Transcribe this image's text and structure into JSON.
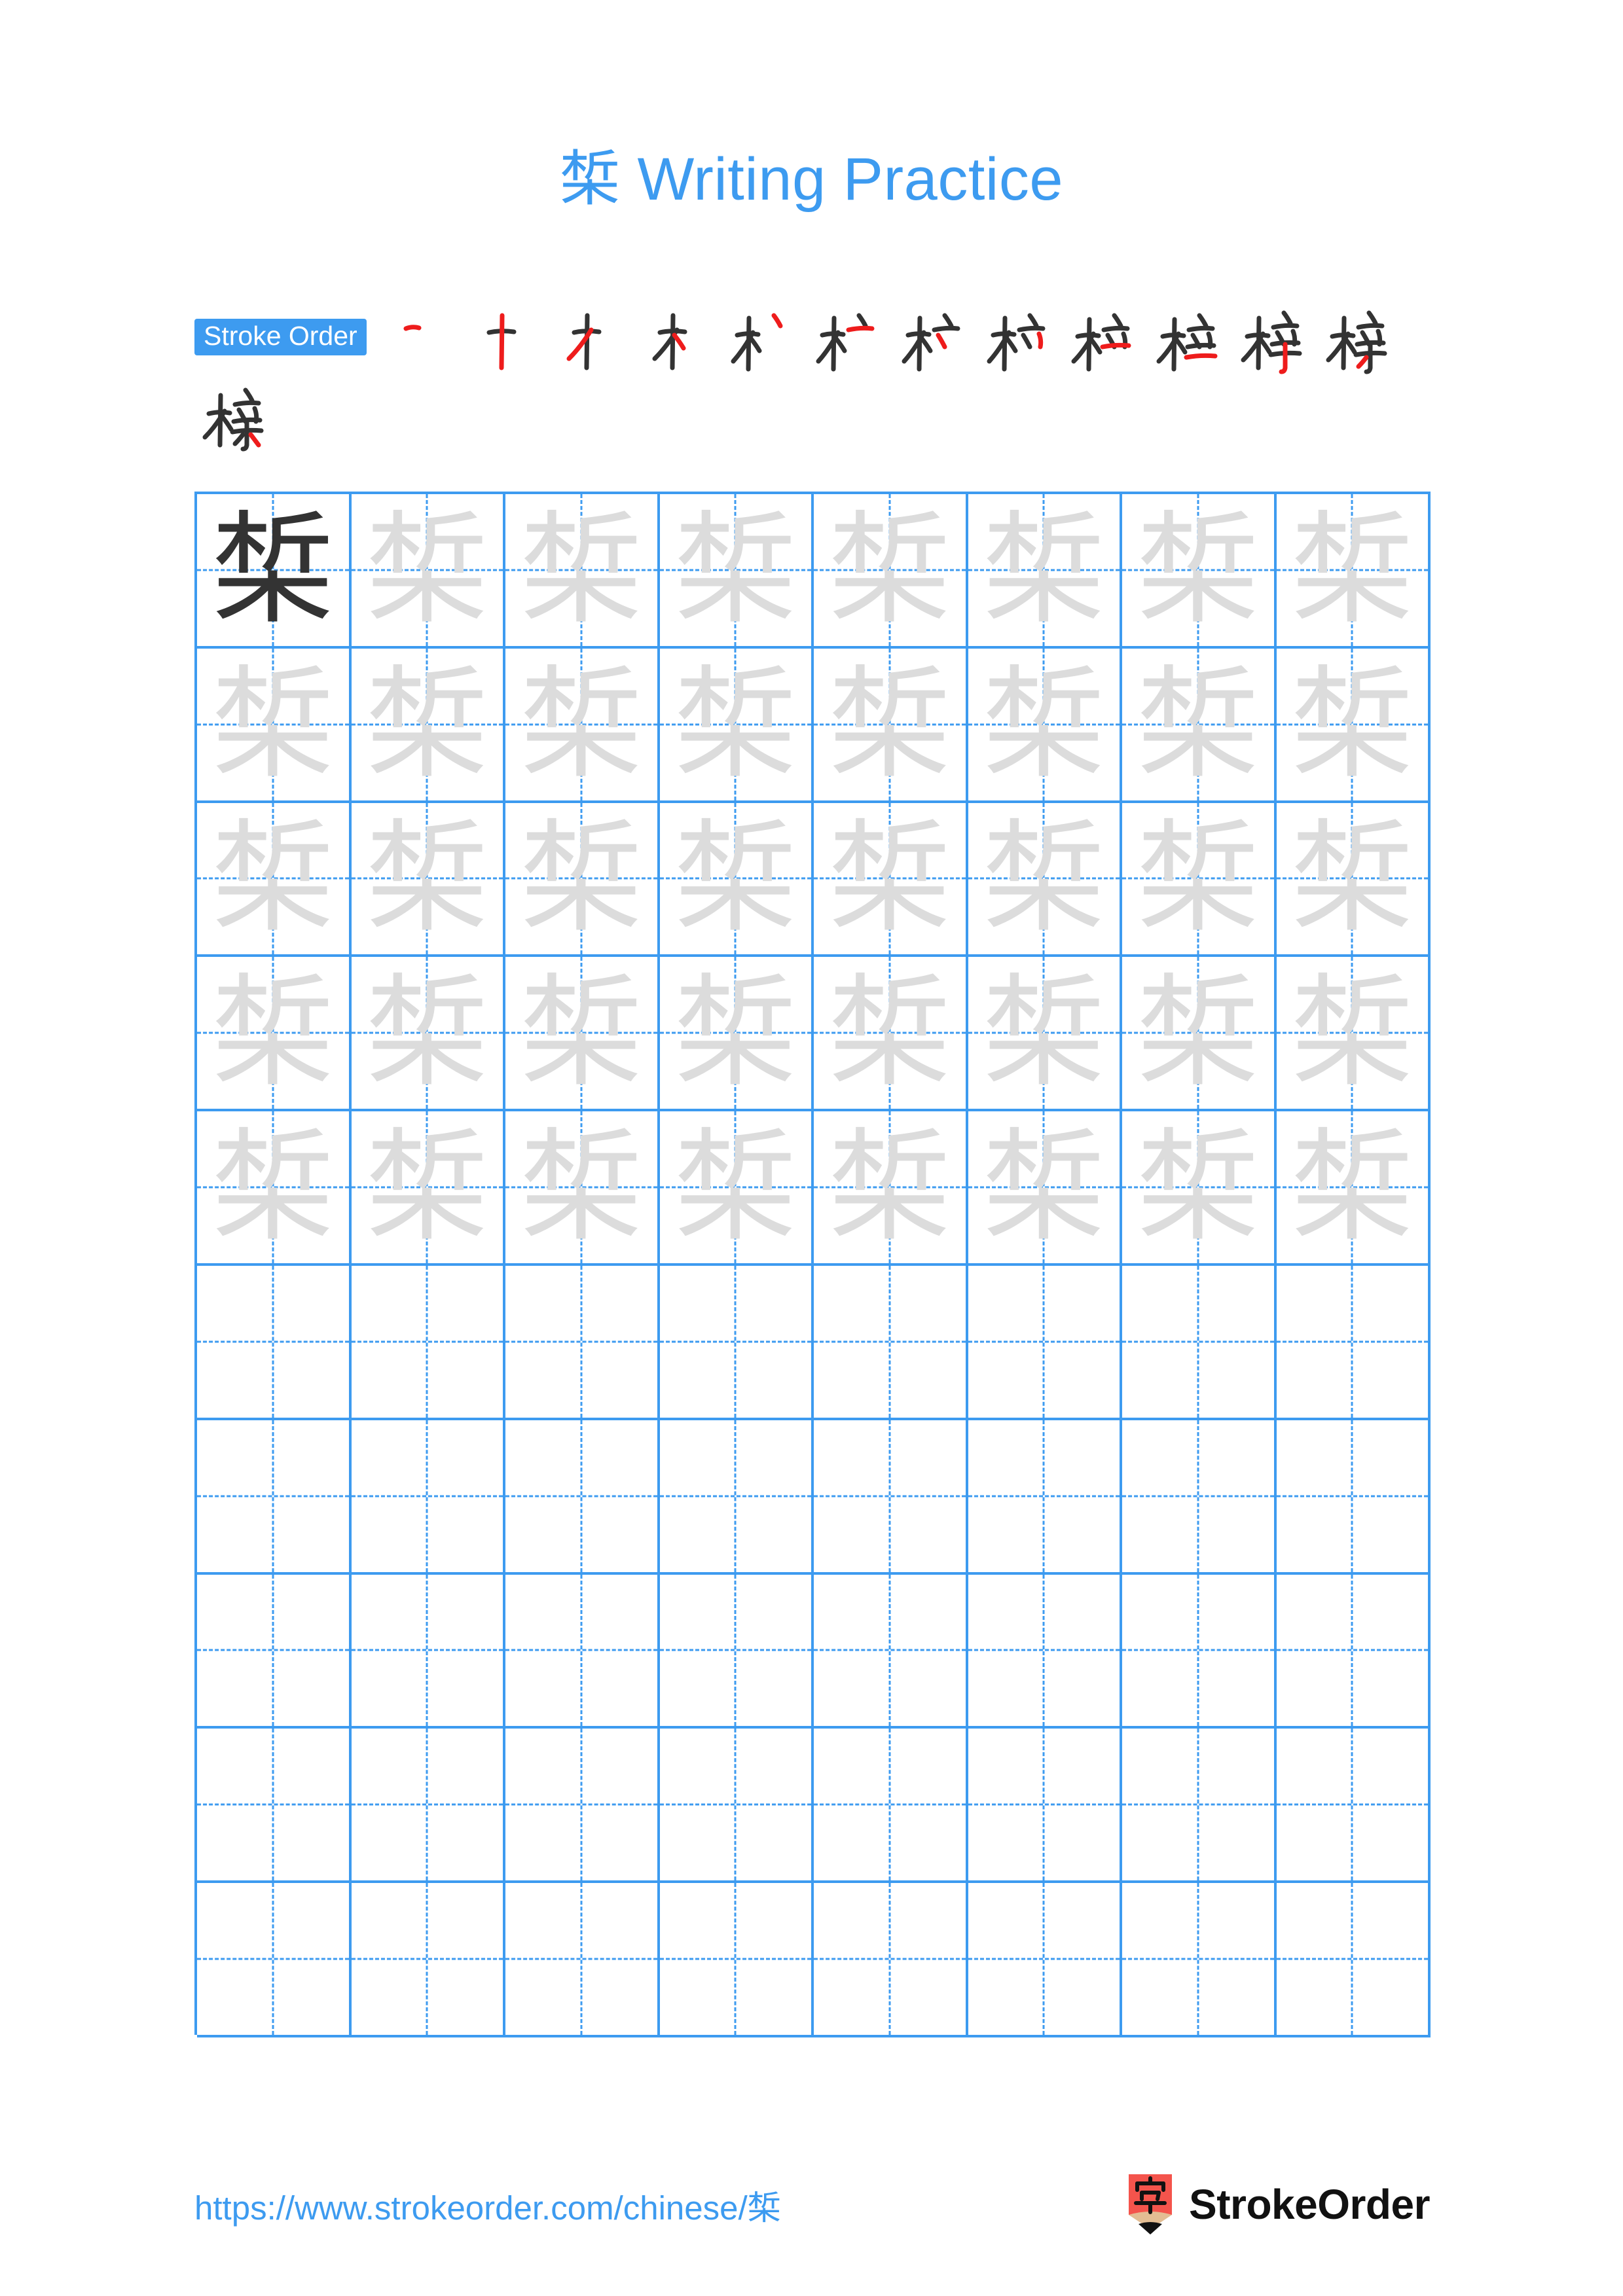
{
  "character": "椞",
  "title": {
    "character": "椞",
    "suffix": " Writing Practice",
    "full": "椞 Writing Practice",
    "color": "#3d9bf0"
  },
  "stroke_order": {
    "badge_label": "Stroke Order",
    "badge_bg": "#3d9bf0",
    "badge_text_color": "#ffffff",
    "total_strokes": 13,
    "ink_color": "#333333",
    "new_stroke_color": "#ee1c1c",
    "steps": [
      {
        "index": 1,
        "new_stroke": "heng (horizontal)",
        "partial": "一"
      },
      {
        "index": 2,
        "new_stroke": "shu (vertical)",
        "partial": "十"
      },
      {
        "index": 3,
        "new_stroke": "pie (left-falling)",
        "partial": "才"
      },
      {
        "index": 4,
        "new_stroke": "dian (dot)",
        "partial": "木"
      },
      {
        "index": 5,
        "new_stroke": "dian (dot, upper right)",
        "partial": "朩丶"
      },
      {
        "index": 6,
        "new_stroke": "heng (horizontal, upper)",
        "partial": "木亠"
      },
      {
        "index": 7,
        "new_stroke": "pie (left-falling, small)",
        "partial": "木亣"
      },
      {
        "index": 8,
        "new_stroke": "na (right-falling, small)",
        "partial": "木产"
      },
      {
        "index": 9,
        "new_stroke": "heng (horizontal, middle)",
        "partial": "杧"
      },
      {
        "index": 10,
        "new_stroke": "heng (horizontal, lower)",
        "partial": "桳"
      },
      {
        "index": 11,
        "new_stroke": "shugou (vertical hook)",
        "partial": "梓"
      },
      {
        "index": 12,
        "new_stroke": "pie (left-falling, bottom)",
        "partial": "椞"
      },
      {
        "index": 13,
        "new_stroke": "dian (dot, bottom right)",
        "partial": "椞"
      }
    ]
  },
  "grid": {
    "columns": 8,
    "rows": 10,
    "border_color": "#3d9bf0",
    "guide_color": "#3d9bf0",
    "solid_char_color": "#333333",
    "trace_char_color": "#dcdcdc",
    "cells": [
      [
        "solid",
        "trace",
        "trace",
        "trace",
        "trace",
        "trace",
        "trace",
        "trace"
      ],
      [
        "trace",
        "trace",
        "trace",
        "trace",
        "trace",
        "trace",
        "trace",
        "trace"
      ],
      [
        "trace",
        "trace",
        "trace",
        "trace",
        "trace",
        "trace",
        "trace",
        "trace"
      ],
      [
        "trace",
        "trace",
        "trace",
        "trace",
        "trace",
        "trace",
        "trace",
        "trace"
      ],
      [
        "trace",
        "trace",
        "trace",
        "trace",
        "trace",
        "trace",
        "trace",
        "trace"
      ],
      [
        "empty",
        "empty",
        "empty",
        "empty",
        "empty",
        "empty",
        "empty",
        "empty"
      ],
      [
        "empty",
        "empty",
        "empty",
        "empty",
        "empty",
        "empty",
        "empty",
        "empty"
      ],
      [
        "empty",
        "empty",
        "empty",
        "empty",
        "empty",
        "empty",
        "empty",
        "empty"
      ],
      [
        "empty",
        "empty",
        "empty",
        "empty",
        "empty",
        "empty",
        "empty",
        "empty"
      ],
      [
        "empty",
        "empty",
        "empty",
        "empty",
        "empty",
        "empty",
        "empty",
        "empty"
      ]
    ]
  },
  "footer": {
    "url": "https://www.strokeorder.com/chinese/椞",
    "url_color": "#3d9bf0",
    "brand_name": "StrokeOrder",
    "logo_character": "字",
    "logo_bg_color": "#f4544c",
    "logo_wood_color": "#e3bd93",
    "logo_tip_color": "#111111"
  }
}
